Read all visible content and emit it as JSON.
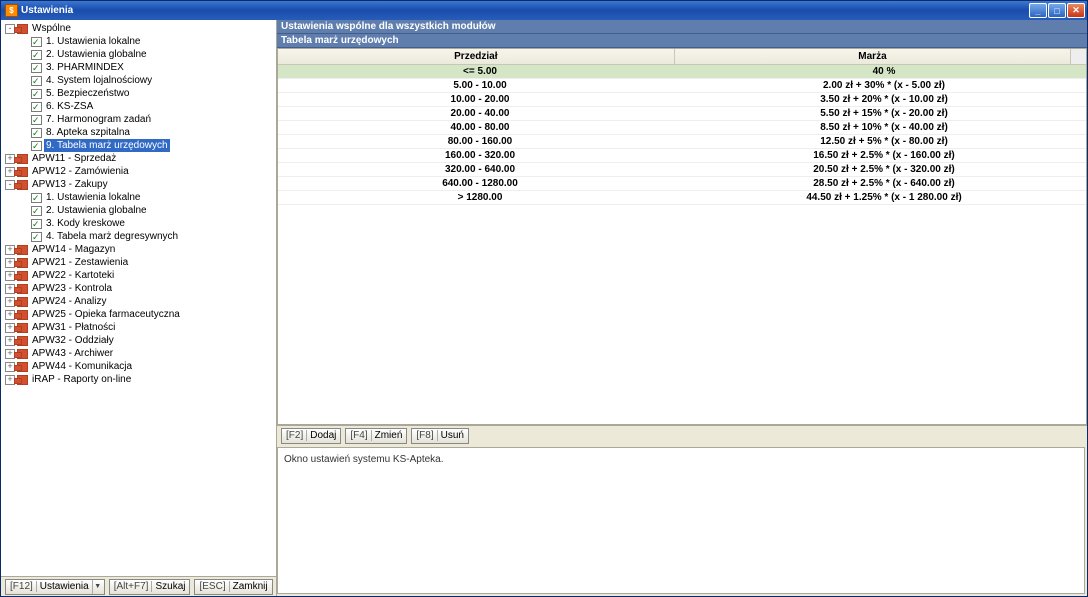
{
  "window": {
    "title": "Ustawienia"
  },
  "buttons": {
    "f12": {
      "key": "[F12]",
      "label": "Ustawienia"
    },
    "altf7": {
      "key": "[Alt+F7]",
      "label": "Szukaj"
    },
    "esc": {
      "key": "[ESC]",
      "label": "Zamknij"
    },
    "f2": {
      "key": "[F2]",
      "label": "Dodaj"
    },
    "f4": {
      "key": "[F4]",
      "label": "Zmień"
    },
    "f8": {
      "key": "[F8]",
      "label": "Usuń"
    }
  },
  "header": {
    "line1": "Ustawienia wspólne dla wszystkich modułów",
    "line2": "Tabela marż urzędowych"
  },
  "table": {
    "columns": [
      "Przedział",
      "Marża"
    ],
    "rows": [
      {
        "range": "<= 5.00",
        "margin": "40 %",
        "selected": true
      },
      {
        "range": "5.00 - 10.00",
        "margin": "2.00 zł + 30% * (x - 5.00 zł)"
      },
      {
        "range": "10.00 - 20.00",
        "margin": "3.50 zł + 20% * (x - 10.00 zł)"
      },
      {
        "range": "20.00 - 40.00",
        "margin": "5.50 zł + 15% * (x - 20.00 zł)"
      },
      {
        "range": "40.00 - 80.00",
        "margin": "8.50 zł + 10% * (x - 40.00 zł)"
      },
      {
        "range": "80.00 - 160.00",
        "margin": "12.50 zł + 5% * (x - 80.00 zł)"
      },
      {
        "range": "160.00 - 320.00",
        "margin": "16.50 zł + 2.5% * (x - 160.00 zł)"
      },
      {
        "range": "320.00 - 640.00",
        "margin": "20.50 zł + 2.5% * (x - 320.00 zł)"
      },
      {
        "range": "640.00 - 1280.00",
        "margin": "28.50 zł + 2.5% * (x - 640.00 zł)"
      },
      {
        "range": "> 1280.00",
        "margin": "44.50 zł + 1.25% * (x - 1 280.00 zł)"
      }
    ]
  },
  "description": "Okno ustawień systemu KS-Apteka.",
  "tree": [
    {
      "depth": 0,
      "twisty": "-",
      "icon": "app",
      "label": "Wspólne"
    },
    {
      "depth": 1,
      "twisty": " ",
      "icon": "opt",
      "label": "1. Ustawienia lokalne"
    },
    {
      "depth": 1,
      "twisty": " ",
      "icon": "opt",
      "label": "2. Ustawienia globalne"
    },
    {
      "depth": 1,
      "twisty": " ",
      "icon": "opt",
      "label": "3. PHARMINDEX"
    },
    {
      "depth": 1,
      "twisty": " ",
      "icon": "opt",
      "label": "4. System lojalnościowy"
    },
    {
      "depth": 1,
      "twisty": " ",
      "icon": "opt",
      "label": "5. Bezpieczeństwo"
    },
    {
      "depth": 1,
      "twisty": " ",
      "icon": "opt",
      "label": "6. KS-ZSA"
    },
    {
      "depth": 1,
      "twisty": " ",
      "icon": "opt",
      "label": "7. Harmonogram zadań"
    },
    {
      "depth": 1,
      "twisty": " ",
      "icon": "opt",
      "label": "8. Apteka szpitalna"
    },
    {
      "depth": 1,
      "twisty": " ",
      "icon": "opt",
      "label": "9. Tabela marż urzędowych",
      "selected": true
    },
    {
      "depth": 0,
      "twisty": "+",
      "icon": "app",
      "label": "APW11 - Sprzedaż"
    },
    {
      "depth": 0,
      "twisty": "+",
      "icon": "app",
      "label": "APW12 - Zamówienia"
    },
    {
      "depth": 0,
      "twisty": "-",
      "icon": "app",
      "label": "APW13 - Zakupy"
    },
    {
      "depth": 1,
      "twisty": " ",
      "icon": "opt",
      "label": "1. Ustawienia lokalne"
    },
    {
      "depth": 1,
      "twisty": " ",
      "icon": "opt",
      "label": "2. Ustawienia globalne"
    },
    {
      "depth": 1,
      "twisty": " ",
      "icon": "opt",
      "label": "3. Kody kreskowe"
    },
    {
      "depth": 1,
      "twisty": " ",
      "icon": "opt",
      "label": "4. Tabela marż degresywnych"
    },
    {
      "depth": 0,
      "twisty": "+",
      "icon": "app",
      "label": "APW14 - Magazyn"
    },
    {
      "depth": 0,
      "twisty": "+",
      "icon": "app",
      "label": "APW21 - Zestawienia"
    },
    {
      "depth": 0,
      "twisty": "+",
      "icon": "app",
      "label": "APW22 - Kartoteki"
    },
    {
      "depth": 0,
      "twisty": "+",
      "icon": "app",
      "label": "APW23 - Kontrola"
    },
    {
      "depth": 0,
      "twisty": "+",
      "icon": "app",
      "label": "APW24 - Analizy"
    },
    {
      "depth": 0,
      "twisty": "+",
      "icon": "app",
      "label": "APW25 - Opieka farmaceutyczna"
    },
    {
      "depth": 0,
      "twisty": "+",
      "icon": "app",
      "label": "APW31 - Płatności"
    },
    {
      "depth": 0,
      "twisty": "+",
      "icon": "app",
      "label": "APW32 - Oddziały"
    },
    {
      "depth": 0,
      "twisty": "+",
      "icon": "app",
      "label": "APW43 - Archiwer"
    },
    {
      "depth": 0,
      "twisty": "+",
      "icon": "app",
      "label": "APW44 - Komunikacja"
    },
    {
      "depth": 0,
      "twisty": "+",
      "icon": "app",
      "label": "iRAP - Raporty on-line"
    }
  ]
}
